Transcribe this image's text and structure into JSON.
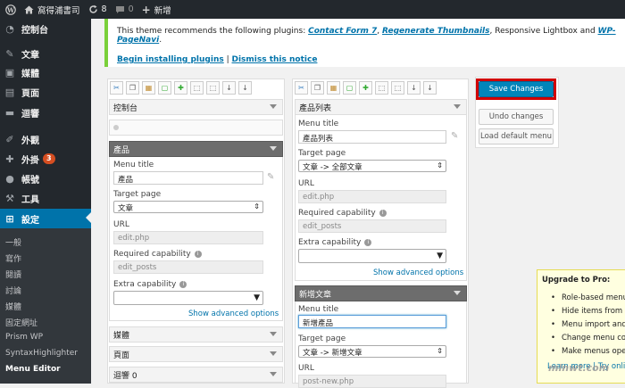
{
  "admin_bar": {
    "site_name": "窩得浦書司",
    "updates_count": "8",
    "comments_count": "0",
    "new_label": "新增"
  },
  "sidebar": {
    "items": [
      {
        "label": "控制台",
        "icon": "dashboard-icon"
      },
      {
        "label": "文章",
        "icon": "pin-icon"
      },
      {
        "label": "媒體",
        "icon": "media-icon"
      },
      {
        "label": "頁面",
        "icon": "page-icon"
      },
      {
        "label": "迴響",
        "icon": "comment-icon"
      },
      {
        "label": "外觀",
        "icon": "brush-icon"
      },
      {
        "label": "外掛",
        "icon": "plugin-icon",
        "badge": "3"
      },
      {
        "label": "帳號",
        "icon": "user-icon"
      },
      {
        "label": "工具",
        "icon": "wrench-icon"
      },
      {
        "label": "設定",
        "icon": "settings-icon"
      }
    ],
    "submenu": [
      "一般",
      "寫作",
      "閱讀",
      "討論",
      "媒體",
      "固定網址",
      "Prism WP",
      "SyntaxHighlighter",
      "Menu Editor"
    ]
  },
  "notice": {
    "prefix": "This theme recommends the following plugins: ",
    "p1": "Contact Form 7",
    "sep1": ", ",
    "p2": "Regenerate Thumbnails",
    "sep2": ", Responsive Lightbox and ",
    "p3": "WP-PageNavi",
    "suffix": ".",
    "begin": "Begin installing plugins",
    "divider": " | ",
    "dismiss": "Dismiss this notice"
  },
  "left_panel": {
    "top_item": "控制台",
    "open_item": "產品",
    "menu_title_label": "Menu title",
    "menu_title": "產品",
    "target_label": "Target page",
    "target": "文章",
    "url_label": "URL",
    "url": "edit.php",
    "cap_label": "Required capability",
    "cap": "edit_posts",
    "extra_label": "Extra capability",
    "advanced": "Show advanced options",
    "bottom_items": [
      "媒體",
      "頁面",
      "迴響 0"
    ]
  },
  "right_panel": {
    "item1": "產品列表",
    "menu_title_label": "Menu title",
    "menu_title": "產品列表",
    "target_label": "Target page",
    "target": "文章 -> 全部文章",
    "url_label": "URL",
    "url": "edit.php",
    "cap_label": "Required capability",
    "cap": "edit_posts",
    "extra_label": "Extra capability",
    "advanced": "Show advanced options",
    "item2": "新增文章",
    "menu_title2": "新增產品",
    "target2": "文章 -> 新增文章",
    "url2": "post-new.php"
  },
  "actions": {
    "save": "Save Changes",
    "undo": "Undo changes",
    "load_default": "Load default menu"
  },
  "upgrade": {
    "title": "Upgrade to Pro:",
    "items": [
      "Role-based menu p",
      "Hide items from sp",
      "Menu import and e",
      "Change menu colo",
      "Make menus open",
      "Learn more | Try online"
    ]
  },
  "watermark": "minwt.com",
  "colors": {
    "accent": "#0073aa",
    "save_button": "#0085ba",
    "highlight_box": "#d00000",
    "notice_border": "#7ad03a"
  }
}
